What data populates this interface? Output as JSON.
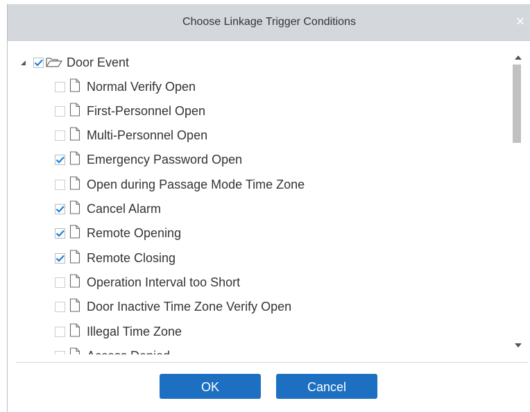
{
  "dialog": {
    "title": "Choose Linkage Trigger Conditions",
    "close_glyph": "×",
    "ok_label": "OK",
    "cancel_label": "Cancel"
  },
  "tree": {
    "root": {
      "label": "Door Event",
      "checked": true,
      "expanded": true,
      "icon": "folder-open-icon"
    },
    "items": [
      {
        "label": "Normal Verify Open",
        "checked": false
      },
      {
        "label": "First-Personnel Open",
        "checked": false
      },
      {
        "label": "Multi-Personnel Open",
        "checked": false
      },
      {
        "label": "Emergency Password Open",
        "checked": true
      },
      {
        "label": "Open during Passage Mode Time Zone",
        "checked": false
      },
      {
        "label": "Cancel Alarm",
        "checked": true
      },
      {
        "label": "Remote Opening",
        "checked": true
      },
      {
        "label": "Remote Closing",
        "checked": true
      },
      {
        "label": "Operation Interval too Short",
        "checked": false
      },
      {
        "label": "Door Inactive Time Zone Verify Open",
        "checked": false
      },
      {
        "label": "Illegal Time Zone",
        "checked": false
      },
      {
        "label": "Access Denied",
        "checked": false
      }
    ]
  },
  "colors": {
    "titlebar": "#d4d8dd",
    "button": "#1d6fc2",
    "check": "#1f7fd6"
  }
}
